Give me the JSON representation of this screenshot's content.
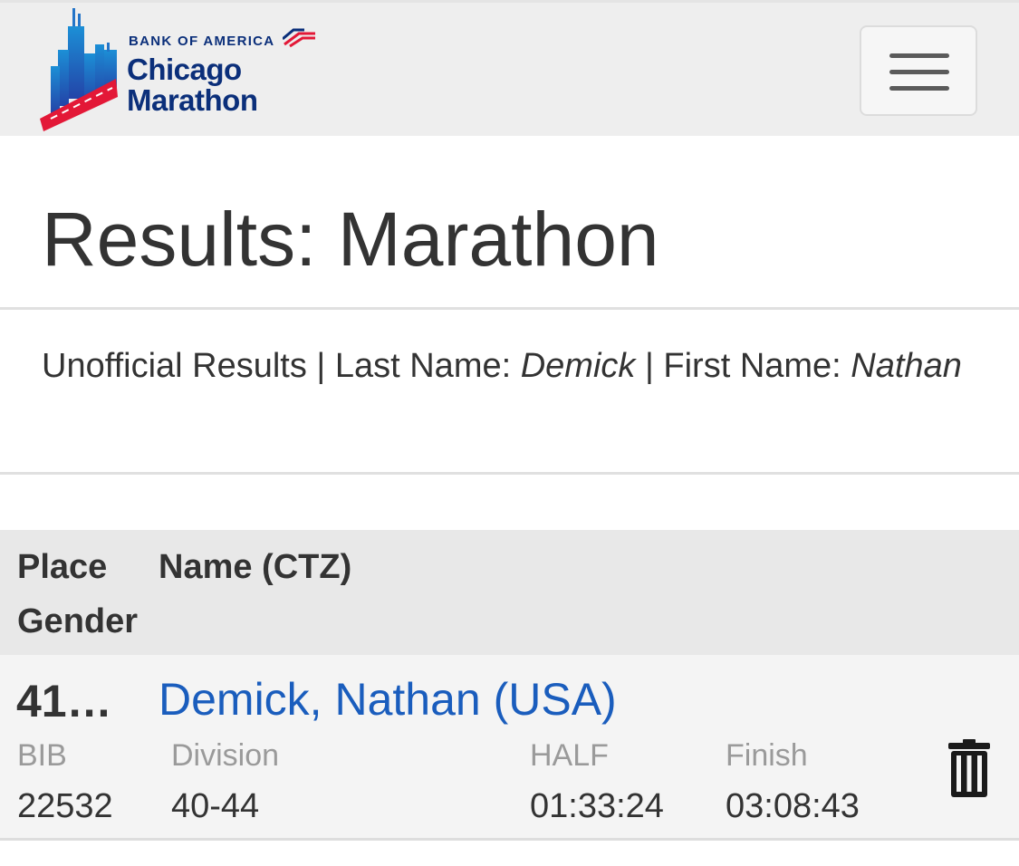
{
  "header": {
    "sponsor": "BANK OF AMERICA",
    "logo_line1": "Chicago",
    "logo_line2": "Marathon",
    "menu_icon": "hamburger-menu-icon",
    "brand_navy": "#0b2f7a",
    "brand_red": "#e31837"
  },
  "page": {
    "title": "Results: Marathon"
  },
  "filter": {
    "prefix": "Unofficial Results | Last Name: ",
    "last_name": "Demick",
    "middle": " | First Name: ",
    "first_name": "Nathan"
  },
  "table": {
    "headers": {
      "place": "Place",
      "gender": "Gender",
      "name": "Name (CTZ)"
    },
    "rows": [
      {
        "place": "41…",
        "name": "Demick, Nathan (USA)",
        "bib_label": "BIB",
        "bib": "22532",
        "division_label": "Division",
        "division": "40-44",
        "half_label": "HALF",
        "half": "01:33:24",
        "finish_label": "Finish",
        "finish": "03:08:43",
        "action_icon": "trash-icon"
      }
    ]
  },
  "colors": {
    "link": "#1a5dbd",
    "header_bg": "#eeeeee",
    "table_head_bg": "#e8e8e8",
    "row_bg": "#f4f4f4"
  }
}
